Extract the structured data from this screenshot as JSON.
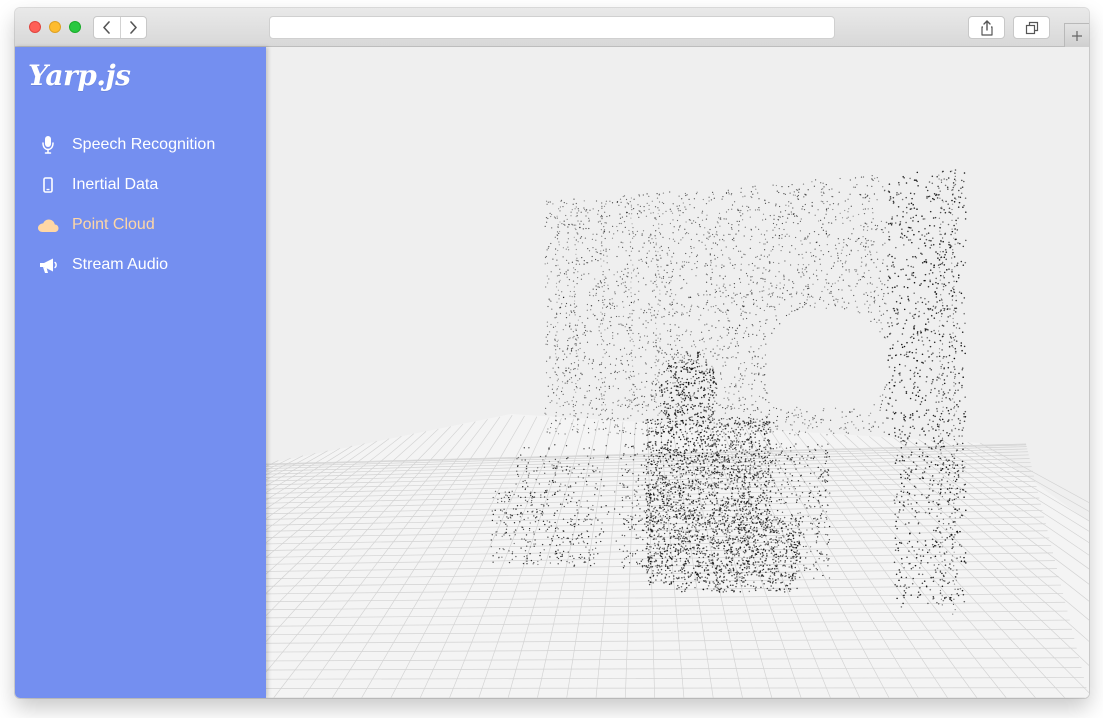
{
  "window": {
    "navigation": {
      "back_icon": "chevron-left-icon",
      "forward_icon": "chevron-right-icon"
    },
    "toolbar": {
      "share_icon": "share-icon",
      "tabs_icon": "tabs-icon",
      "new_tab_icon": "plus-icon"
    }
  },
  "sidebar": {
    "brand": "Yarp.js",
    "items": [
      {
        "label": "Speech Recognition",
        "icon": "microphone-icon",
        "active": false
      },
      {
        "label": "Inertial Data",
        "icon": "phone-icon",
        "active": false
      },
      {
        "label": "Point Cloud",
        "icon": "cloud-icon",
        "active": true
      },
      {
        "label": "Stream Audio",
        "icon": "megaphone-icon",
        "active": false
      }
    ]
  },
  "viewer": {
    "view": "point cloud",
    "floor": "grid",
    "colors": {
      "background": "#efefef",
      "grid": "#d2d2d2",
      "points": "#000000",
      "sidebar": "#748ff0",
      "active_item": "#ffd7a5"
    }
  }
}
